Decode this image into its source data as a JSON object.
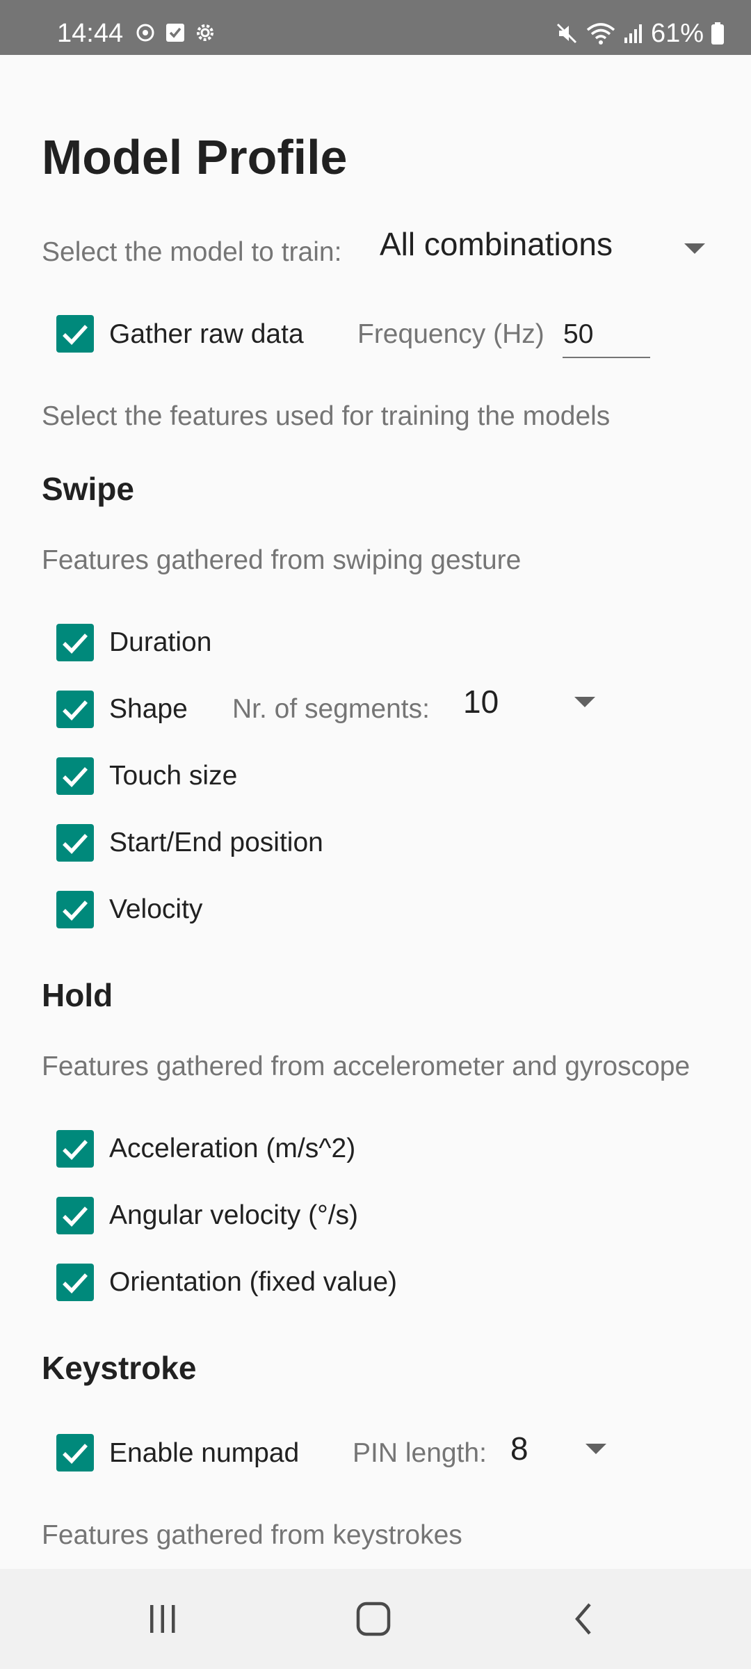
{
  "status_bar": {
    "time": "14:44",
    "battery": "61%",
    "left_icons": [
      "sync-icon",
      "check-square-icon",
      "settings-gear-icon"
    ],
    "right_icons": [
      "mute-icon",
      "wifi-icon",
      "signal-icon",
      "battery-icon"
    ]
  },
  "page": {
    "title": "Model Profile"
  },
  "model_select": {
    "label": "Select the model to train:",
    "value": "All combinations"
  },
  "raw_data": {
    "checkbox_label": "Gather raw data",
    "checked": true,
    "frequency_label": "Frequency (Hz)",
    "frequency_value": "50"
  },
  "features_intro": "Select the features used for training the models",
  "swipe": {
    "title": "Swipe",
    "description": "Features gathered from swiping gesture",
    "items": [
      {
        "label": "Duration",
        "checked": true
      },
      {
        "label": "Shape",
        "checked": true
      },
      {
        "label": "Touch size",
        "checked": true
      },
      {
        "label": "Start/End position",
        "checked": true
      },
      {
        "label": "Velocity",
        "checked": true
      }
    ],
    "segments_label": "Nr. of segments:",
    "segments_value": "10"
  },
  "hold": {
    "title": "Hold",
    "description": "Features gathered from accelerometer and gyroscope",
    "items": [
      {
        "label": "Acceleration (m/s^2)",
        "checked": true
      },
      {
        "label": "Angular velocity (°/s)",
        "checked": true
      },
      {
        "label": "Orientation (fixed value)",
        "checked": true
      }
    ]
  },
  "keystroke": {
    "title": "Keystroke",
    "numpad_label": "Enable numpad",
    "numpad_checked": true,
    "pin_length_label": "PIN length:",
    "pin_length_value": "8",
    "description": "Features gathered from keystrokes"
  },
  "colors": {
    "accent": "#00897b",
    "status_bar": "#757575",
    "background": "#fafafa",
    "nav_bar": "#f1f1f1"
  },
  "nav_bar": {
    "buttons": [
      "recent-apps-icon",
      "home-icon",
      "back-icon"
    ]
  }
}
